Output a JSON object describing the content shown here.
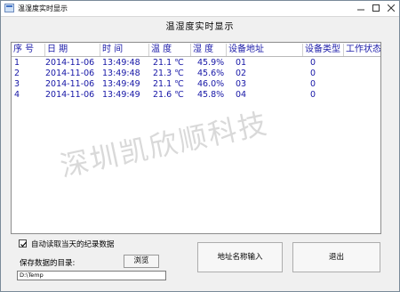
{
  "window": {
    "title": "温湿度实时显示",
    "minimize_label": "–",
    "maximize_label": "□",
    "close_label": "✕"
  },
  "heading": "温湿度实时显示",
  "table": {
    "columns": [
      "序  号",
      "日  期",
      "时  间",
      "温  度",
      "湿    度",
      "设备地址",
      "设备类型",
      "工作状态"
    ],
    "rows": [
      {
        "index": "1",
        "date": "2014-11-06",
        "time": "13:49:48",
        "temp": "21.1 ℃",
        "humidity": "45.9%",
        "address": "01",
        "type": "0",
        "status": ""
      },
      {
        "index": "2",
        "date": "2014-11-06",
        "time": "13:49:48",
        "temp": "21.3 ℃",
        "humidity": "45.6%",
        "address": "02",
        "type": "0",
        "status": ""
      },
      {
        "index": "3",
        "date": "2014-11-06",
        "time": "13:49:49",
        "temp": "21.1 ℃",
        "humidity": "46.0%",
        "address": "03",
        "type": "0",
        "status": ""
      },
      {
        "index": "4",
        "date": "2014-11-06",
        "time": "13:49:49",
        "temp": "21.6 ℃",
        "humidity": "45.8%",
        "address": "04",
        "type": "0",
        "status": ""
      }
    ]
  },
  "watermark": "深圳凯欣顺科技",
  "auto_read": {
    "label": "自动读取当天的纪录数据",
    "checked": true
  },
  "save": {
    "label": "保存数据的目录:",
    "browse_label": "浏览",
    "path": "D:\\Temp"
  },
  "buttons": {
    "address_input": "地址名称输入",
    "exit": "退出"
  },
  "colors": {
    "table_text": "#1616a6",
    "header_text": "#1a1aa8"
  }
}
